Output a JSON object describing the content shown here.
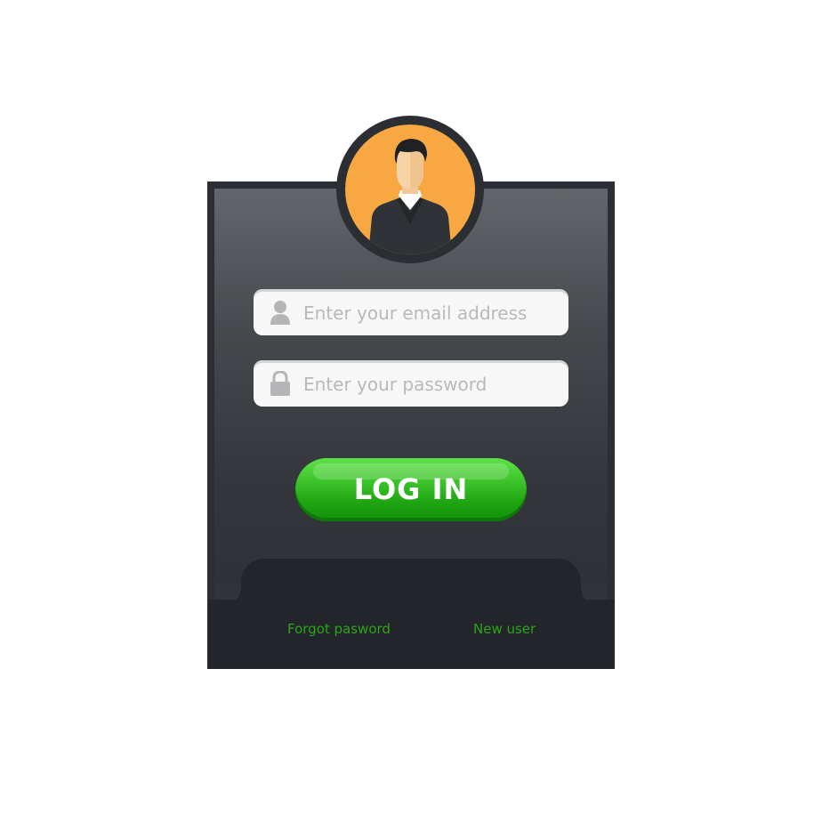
{
  "login": {
    "email_placeholder": "Enter your email address",
    "password_placeholder": "Enter your password",
    "email_value": "",
    "password_value": "",
    "submit_label": "LOG IN",
    "forgot_label": "Forgot pasword",
    "new_user_label": "New user"
  },
  "icons": {
    "avatar": "user-avatar-icon",
    "email_field": "user-icon",
    "password_field": "lock-icon"
  },
  "colors": {
    "accent_green": "#2ea31c",
    "button_green": "#3fc52c",
    "avatar_bg": "#f7a842",
    "card_dark": "#2b2f33"
  }
}
